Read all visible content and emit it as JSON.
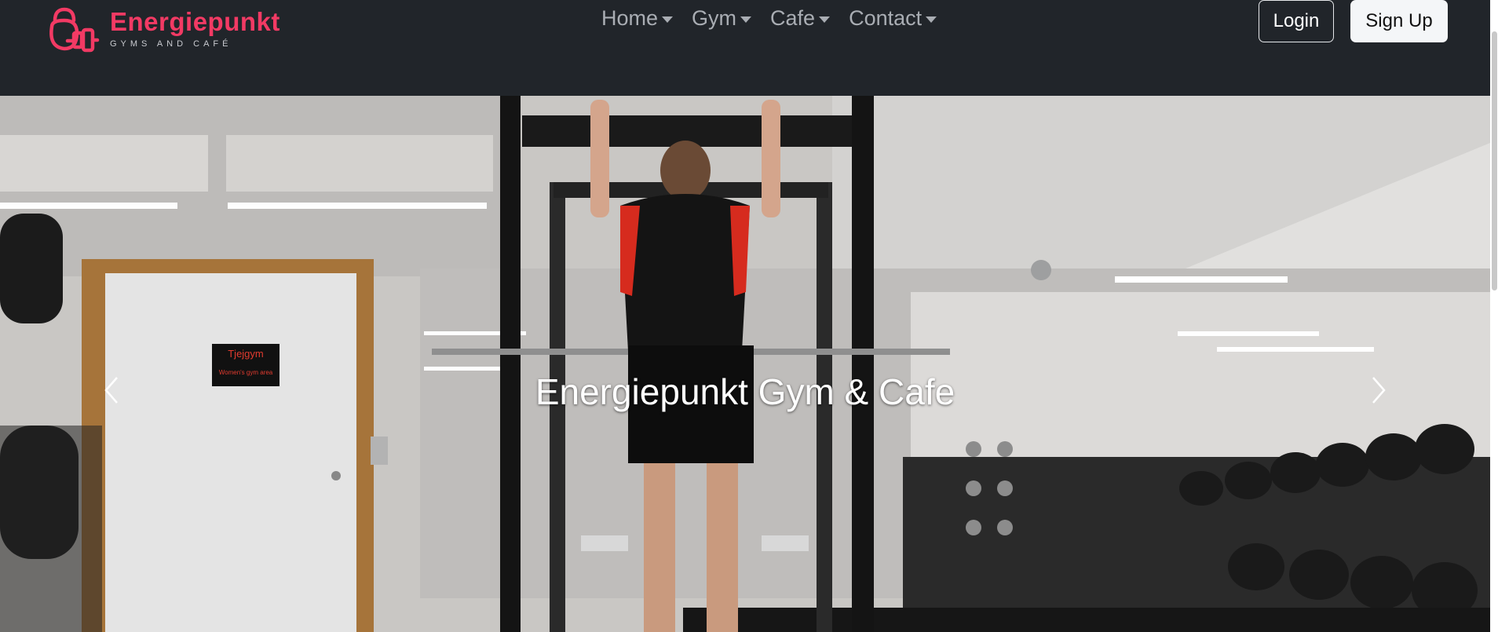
{
  "brand": {
    "name": "Energiepunkt",
    "tagline": "GYMS AND CAFÉ",
    "color": "#f23a64"
  },
  "nav": {
    "items": [
      {
        "label": "Home"
      },
      {
        "label": "Gym"
      },
      {
        "label": "Cafe"
      },
      {
        "label": "Contact"
      }
    ]
  },
  "auth": {
    "login_label": "Login",
    "signup_label": "Sign Up"
  },
  "hero": {
    "caption": "Energiepunkt Gym & Cafe",
    "door_sign_title": "Tjejgym",
    "door_sign_subtitle": "Women's gym area",
    "prev_icon": "chevron-left-icon",
    "next_icon": "chevron-right-icon"
  }
}
